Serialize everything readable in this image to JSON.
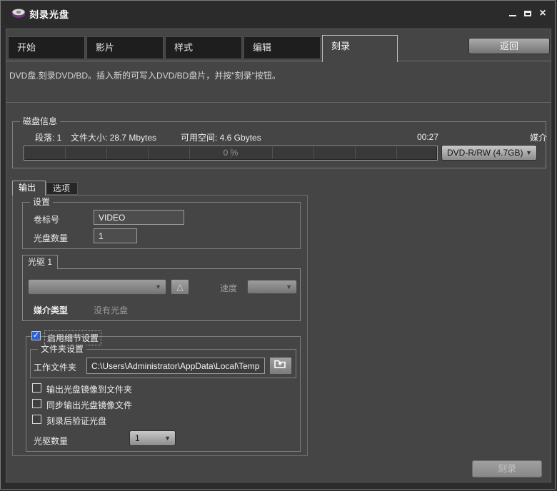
{
  "window": {
    "title": "刻录光盘",
    "controls": {
      "minimize_icon": "minimize",
      "maximize_icon": "maximize",
      "close_glyph": "×"
    }
  },
  "tabs": [
    {
      "label": "开始"
    },
    {
      "label": "影片"
    },
    {
      "label": "样式"
    },
    {
      "label": "编辑"
    },
    {
      "label": "刻录",
      "active": true
    }
  ],
  "back_button_label": "返回",
  "description": "DVD盘.刻录DVD/BD。插入新的可写入DVD/BD盘片，并按\"刻录\"按钮。",
  "disc_info": {
    "group_title": "磁盘信息",
    "chapters": "段落: 1",
    "file_size": "文件大小: 28.7 Mbytes",
    "free_space": "可用空间: 4.6 Gbytes",
    "duration": "00:27",
    "media_label": "媒介",
    "progress_text": "0 %",
    "media_value": "DVD-R/RW (4.7GB)"
  },
  "sub_tabs": {
    "output": "输出",
    "options": "选项"
  },
  "settings_group": {
    "title": "设置",
    "volume_label": "卷标号",
    "volume_value": "VIDEO",
    "disc_count_label": "光盘数量",
    "disc_count_value": "1"
  },
  "drive_group": {
    "tab_title": "光驱 1",
    "drive_value": "",
    "eject_glyph": "△",
    "speed_label": "速度",
    "speed_value": "",
    "media_type_label": "媒介类型",
    "media_type_value": "没有光盘"
  },
  "details_group": {
    "enable_label": "启用细节设置",
    "enable_checked": "✓",
    "folder_group_title": "文件夹设置",
    "working_folder_label": "工作文件夹",
    "working_folder_value": "C:\\Users\\Administrator\\AppData\\Local\\Temp",
    "checkbox_labels": [
      "输出光盘镜像到文件夹",
      "同步输出光盘镜像文件",
      "刻录后验证光盘"
    ],
    "drive_count_label": "光驱数量",
    "drive_count_value": "1"
  },
  "burn_button_label": "刻录",
  "dropdown_arrow": "▼",
  "colors": {
    "content_bg": "#454545",
    "titlebar_bg": "#2b2b2b",
    "checkbox_checked": "#2c63cc",
    "disc_icon_purple": "#7b2d8e",
    "disabled_text": "#9b9b9b"
  }
}
